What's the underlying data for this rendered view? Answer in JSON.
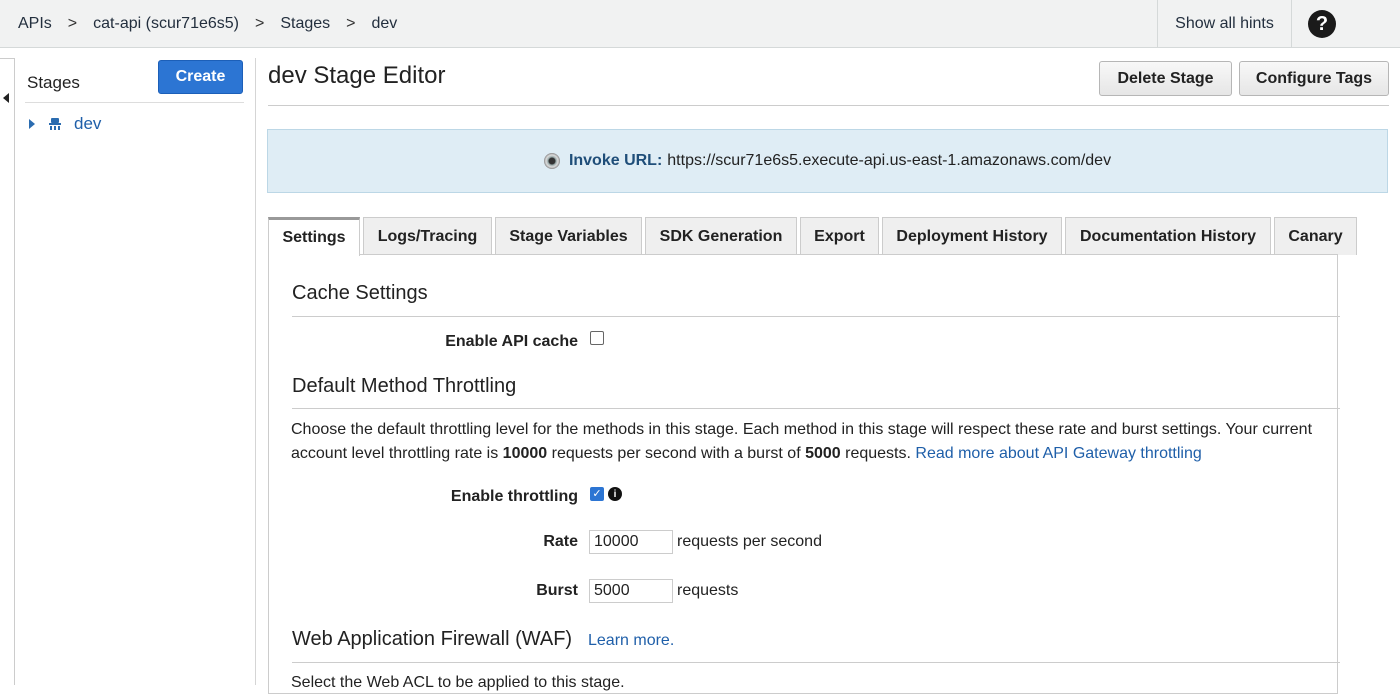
{
  "breadcrumb": {
    "items": [
      "APIs",
      "cat-api (scur71e6s5)",
      "Stages",
      "dev"
    ],
    "separator": ">"
  },
  "header": {
    "hints_label": "Show all hints",
    "help_icon": "?"
  },
  "stages": {
    "title": "Stages",
    "create_label": "Create",
    "items": [
      {
        "label": "dev"
      }
    ]
  },
  "editor": {
    "title": "dev Stage Editor",
    "delete_label": "Delete Stage",
    "configure_tags_label": "Configure Tags",
    "invoke_label": "Invoke URL:",
    "invoke_url": "https://scur71e6s5.execute-api.us-east-1.amazonaws.com/dev"
  },
  "tabs": [
    {
      "label": "Settings",
      "active": true
    },
    {
      "label": "Logs/Tracing"
    },
    {
      "label": "Stage Variables"
    },
    {
      "label": "SDK Generation"
    },
    {
      "label": "Export"
    },
    {
      "label": "Deployment History"
    },
    {
      "label": "Documentation History"
    },
    {
      "label": "Canary"
    }
  ],
  "cache": {
    "heading": "Cache Settings",
    "enable_label": "Enable API cache",
    "enabled": false
  },
  "throttling": {
    "heading": "Default Method Throttling",
    "desc_1": "Choose the default throttling level for the methods in this stage. Each method in this stage will respect these rate and burst settings. Your current account level throttling rate is ",
    "rate_bold": "10000",
    "desc_2": " requests per second with a burst of ",
    "burst_bold": "5000",
    "desc_3": " requests. ",
    "read_more": "Read more about API Gateway throttling",
    "enable_label": "Enable throttling",
    "enabled": true,
    "rate_label": "Rate",
    "rate_value": "10000",
    "rate_unit": "requests per second",
    "burst_label": "Burst",
    "burst_value": "5000",
    "burst_unit": "requests"
  },
  "waf": {
    "heading": "Web Application Firewall (WAF)",
    "learn_more": "Learn more.",
    "desc": "Select the Web ACL to be applied to this stage."
  },
  "colors": {
    "primary": "#2c75d3",
    "link": "#1f5fa9",
    "info_bg": "#dfedf5"
  }
}
